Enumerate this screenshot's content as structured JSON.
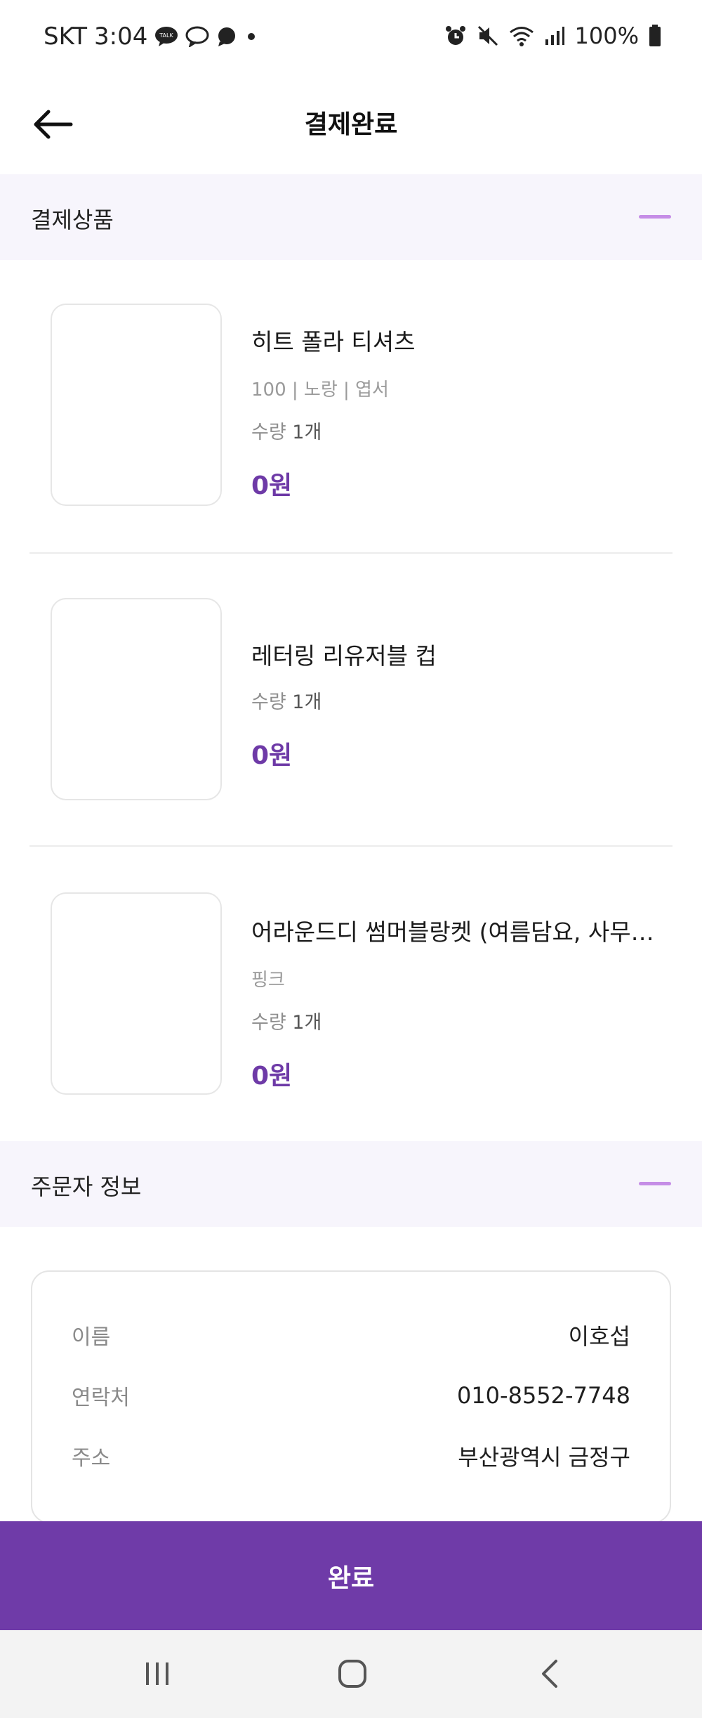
{
  "status_bar": {
    "carrier": "SKT",
    "time": "3:04",
    "battery": "100%",
    "left_icons": [
      "talk-bubble-icon",
      "chat-bubble-icon",
      "message-icon",
      "dot-icon"
    ],
    "right_icons": [
      "alarm-icon",
      "mute-icon",
      "wifi-icon",
      "signal-icon",
      "battery-icon"
    ]
  },
  "header": {
    "title": "결제완료",
    "back_icon": "arrow-left-icon"
  },
  "sections": {
    "products_title": "결제상품",
    "orderer_title": "주문자 정보"
  },
  "products": [
    {
      "name": "히트 폴라 티셔츠",
      "option": "100 | 노랑 | 엽서",
      "qty_label": "수량",
      "qty": "1개",
      "price": "0원"
    },
    {
      "name": "레터링 리유저블 컵",
      "option": "",
      "qty_label": "수량",
      "qty": "1개",
      "price": "0원"
    },
    {
      "name": "어라운드디 썸머블랑켓 (여름담요, 사무실담요, 캠핑담요)",
      "option": "핑크",
      "qty_label": "수량",
      "qty": "1개",
      "price": "0원"
    }
  ],
  "orderer": {
    "rows": [
      {
        "label": "이름",
        "value": "이호섭"
      },
      {
        "label": "연락처",
        "value": "010-8552-7748"
      },
      {
        "label": "주소",
        "value": "부산광역시 금정구"
      }
    ]
  },
  "complete_button": {
    "label": "완료"
  },
  "nav_bar": {
    "icons": [
      "recent-apps-icon",
      "home-icon",
      "back-icon"
    ]
  },
  "colors": {
    "accent": "#6f3ba8",
    "price": "#6e3aa7",
    "collapse": "#c58de6",
    "section_bg": "#f7f5fc"
  }
}
